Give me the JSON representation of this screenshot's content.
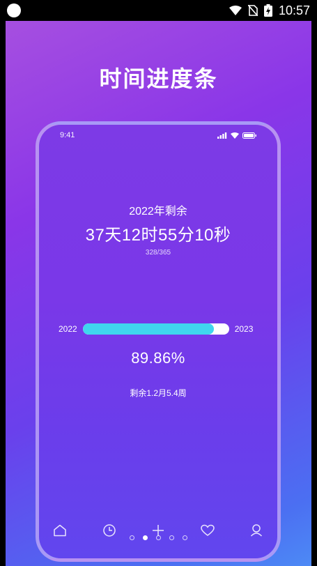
{
  "statusbar": {
    "time": "10:57"
  },
  "promo": {
    "title": "时间进度条"
  },
  "mockup": {
    "status_time": "9:41",
    "remain_label": "2022年剩余",
    "remain_value": "37天12时55分10秒",
    "day_count": "328/365",
    "year_start": "2022",
    "year_end": "2023",
    "progress_fraction": 0.8986,
    "percent_label": "89.86%",
    "weeks_left": "剩余1.2月5.4周",
    "tabs": [
      "home-icon",
      "clock-icon",
      "plus-icon",
      "heart-icon",
      "profile-icon"
    ]
  },
  "pager": {
    "count": 5,
    "active_index": 1
  },
  "colors": {
    "progress_fill": "#40d6ee",
    "progress_track": "#ffffff",
    "gradient_top": "#a64fe0",
    "gradient_bottom": "#4d8af5"
  }
}
